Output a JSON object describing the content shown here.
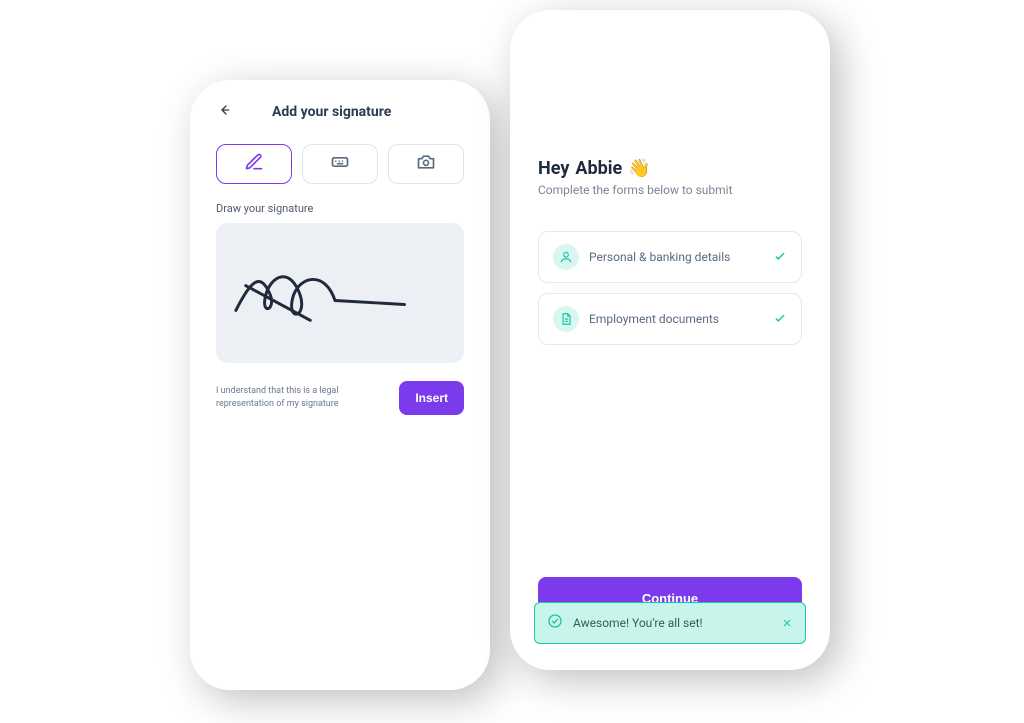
{
  "left": {
    "title": "Add your signature",
    "draw_label": "Draw your signature",
    "legal_text": "I understand that this is a legal representation of my signature",
    "insert_label": "Insert"
  },
  "right": {
    "greeting_prefix": "Hey ",
    "greeting_name": "Abbie",
    "wave_emoji": "👋",
    "subtitle": "Complete the forms below to submit",
    "items": [
      {
        "label": "Personal & banking details",
        "done": true
      },
      {
        "label": "Employment documents",
        "done": true
      }
    ],
    "continue_label": "Continue",
    "toast_text": "Awesome! You're all set!"
  },
  "colors": {
    "accent": "#7c3aed",
    "teal": "#19c6a5"
  }
}
